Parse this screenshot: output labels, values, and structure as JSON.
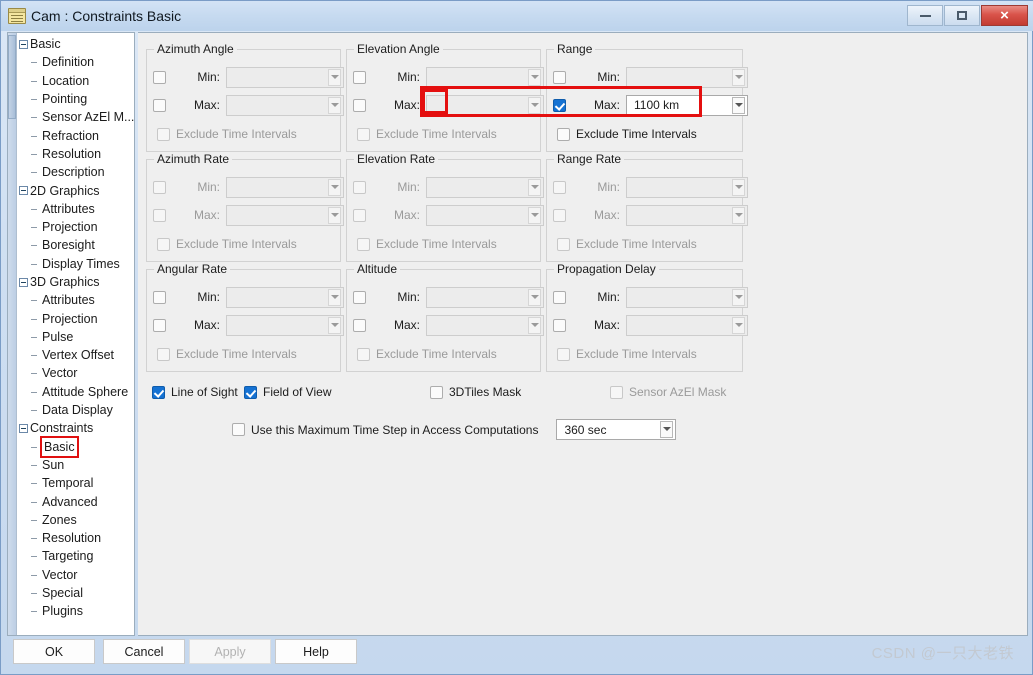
{
  "window": {
    "title": "Cam : Constraints Basic",
    "icon": "notepad-icon",
    "minimize_label": "",
    "maximize_label": "",
    "close_label": "×"
  },
  "tree": {
    "items": [
      {
        "label": "Basic",
        "level": 0,
        "expander": "collapse",
        "selected": false
      },
      {
        "label": "Definition",
        "level": 1,
        "expander": "leaf",
        "selected": false
      },
      {
        "label": "Location",
        "level": 1,
        "expander": "leaf",
        "selected": false
      },
      {
        "label": "Pointing",
        "level": 1,
        "expander": "leaf",
        "selected": false
      },
      {
        "label": "Sensor AzEl M...",
        "level": 1,
        "expander": "leaf",
        "selected": false
      },
      {
        "label": "Refraction",
        "level": 1,
        "expander": "leaf",
        "selected": false
      },
      {
        "label": "Resolution",
        "level": 1,
        "expander": "leaf",
        "selected": false
      },
      {
        "label": "Description",
        "level": 1,
        "expander": "leaf",
        "selected": false
      },
      {
        "label": "2D Graphics",
        "level": 0,
        "expander": "collapse",
        "selected": false
      },
      {
        "label": "Attributes",
        "level": 1,
        "expander": "leaf",
        "selected": false
      },
      {
        "label": "Projection",
        "level": 1,
        "expander": "leaf",
        "selected": false
      },
      {
        "label": "Boresight",
        "level": 1,
        "expander": "leaf",
        "selected": false
      },
      {
        "label": "Display Times",
        "level": 1,
        "expander": "leaf",
        "selected": false
      },
      {
        "label": "3D Graphics",
        "level": 0,
        "expander": "collapse",
        "selected": false
      },
      {
        "label": "Attributes",
        "level": 1,
        "expander": "leaf",
        "selected": false
      },
      {
        "label": "Projection",
        "level": 1,
        "expander": "leaf",
        "selected": false
      },
      {
        "label": "Pulse",
        "level": 1,
        "expander": "leaf",
        "selected": false
      },
      {
        "label": "Vertex Offset",
        "level": 1,
        "expander": "leaf",
        "selected": false
      },
      {
        "label": "Vector",
        "level": 1,
        "expander": "leaf",
        "selected": false
      },
      {
        "label": "Attitude Sphere",
        "level": 1,
        "expander": "leaf",
        "selected": false
      },
      {
        "label": "Data Display",
        "level": 1,
        "expander": "leaf",
        "selected": false
      },
      {
        "label": "Constraints",
        "level": 0,
        "expander": "collapse",
        "selected": false
      },
      {
        "label": "Basic",
        "level": 1,
        "expander": "leaf",
        "selected": true
      },
      {
        "label": "Sun",
        "level": 1,
        "expander": "leaf",
        "selected": false
      },
      {
        "label": "Temporal",
        "level": 1,
        "expander": "leaf",
        "selected": false
      },
      {
        "label": "Advanced",
        "level": 1,
        "expander": "leaf",
        "selected": false
      },
      {
        "label": "Zones",
        "level": 1,
        "expander": "leaf",
        "selected": false
      },
      {
        "label": "Resolution",
        "level": 1,
        "expander": "leaf",
        "selected": false
      },
      {
        "label": "Targeting",
        "level": 1,
        "expander": "leaf",
        "selected": false
      },
      {
        "label": "Vector",
        "level": 1,
        "expander": "leaf",
        "selected": false
      },
      {
        "label": "Special",
        "level": 1,
        "expander": "leaf",
        "selected": false
      },
      {
        "label": "Plugins",
        "level": 1,
        "expander": "leaf",
        "selected": false
      }
    ]
  },
  "labels": {
    "min": "Min:",
    "max": "Max:",
    "exclude": "Exclude Time Intervals"
  },
  "groups": [
    {
      "title": "Azimuth Angle",
      "min": {
        "checked": false,
        "enabled": true,
        "value": ""
      },
      "max": {
        "checked": false,
        "enabled": true,
        "value": ""
      },
      "exclude": {
        "checked": false,
        "enabled": false
      }
    },
    {
      "title": "Elevation Angle",
      "min": {
        "checked": false,
        "enabled": true,
        "value": ""
      },
      "max": {
        "checked": false,
        "enabled": true,
        "value": ""
      },
      "exclude": {
        "checked": false,
        "enabled": false
      }
    },
    {
      "title": "Range",
      "min": {
        "checked": false,
        "enabled": true,
        "value": ""
      },
      "max": {
        "checked": true,
        "enabled": true,
        "value": "1100 km"
      },
      "exclude": {
        "checked": false,
        "enabled": true
      }
    },
    {
      "title": "Azimuth Rate",
      "min": {
        "checked": false,
        "enabled": false,
        "value": ""
      },
      "max": {
        "checked": false,
        "enabled": false,
        "value": ""
      },
      "exclude": {
        "checked": false,
        "enabled": false
      }
    },
    {
      "title": "Elevation Rate",
      "min": {
        "checked": false,
        "enabled": false,
        "value": ""
      },
      "max": {
        "checked": false,
        "enabled": false,
        "value": ""
      },
      "exclude": {
        "checked": false,
        "enabled": false
      }
    },
    {
      "title": "Range Rate",
      "min": {
        "checked": false,
        "enabled": false,
        "value": ""
      },
      "max": {
        "checked": false,
        "enabled": false,
        "value": ""
      },
      "exclude": {
        "checked": false,
        "enabled": false
      }
    },
    {
      "title": "Angular Rate",
      "min": {
        "checked": false,
        "enabled": true,
        "value": ""
      },
      "max": {
        "checked": false,
        "enabled": true,
        "value": ""
      },
      "exclude": {
        "checked": false,
        "enabled": false
      }
    },
    {
      "title": "Altitude",
      "min": {
        "checked": false,
        "enabled": true,
        "value": ""
      },
      "max": {
        "checked": false,
        "enabled": true,
        "value": ""
      },
      "exclude": {
        "checked": false,
        "enabled": false
      }
    },
    {
      "title": "Propagation Delay",
      "min": {
        "checked": false,
        "enabled": true,
        "value": ""
      },
      "max": {
        "checked": false,
        "enabled": true,
        "value": ""
      },
      "exclude": {
        "checked": false,
        "enabled": false
      }
    }
  ],
  "flags": [
    {
      "label": "Line of Sight",
      "checked": true,
      "enabled": true
    },
    {
      "label": "Field of View",
      "checked": true,
      "enabled": true
    },
    {
      "label": "3DTiles Mask",
      "checked": false,
      "enabled": true
    },
    {
      "label": "Sensor AzEl Mask",
      "checked": false,
      "enabled": false
    }
  ],
  "timestep": {
    "label": "Use this Maximum Time Step in Access Computations",
    "checked": false,
    "value": "360 sec"
  },
  "footer": {
    "ok": "OK",
    "cancel": "Cancel",
    "apply": "Apply",
    "apply_enabled": false,
    "help": "Help"
  },
  "watermark": "CSDN @一只大老铁",
  "colors": {
    "accent": "#1572d3",
    "highlight": "#e40f0f",
    "titlebar": "#c6daf0",
    "close": "#d9534a"
  }
}
